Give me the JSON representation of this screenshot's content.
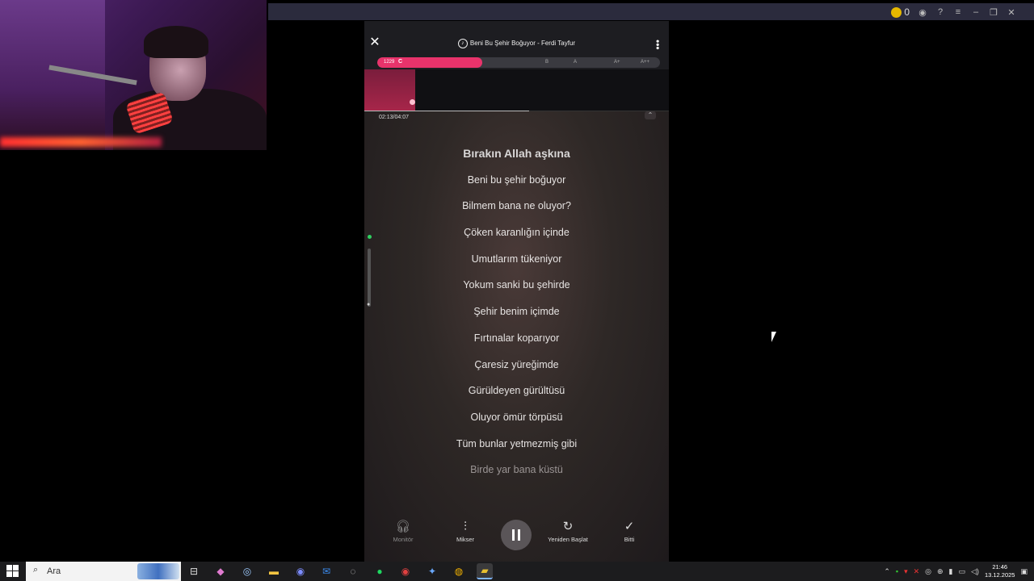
{
  "app": {
    "song_title": "Beni Bu Şehir Boğuyor - Ferdi Tayfur",
    "score": {
      "value": "1229",
      "grade": "C",
      "fill_fraction": 0.37
    },
    "grades": [
      "B",
      "A",
      "A+",
      "A++"
    ],
    "time": "02:13/04:07",
    "progress_fraction": 0.54,
    "lyrics": [
      "Bırakın Allah aşkına",
      "Beni bu şehir boğuyor",
      "Bilmem bana ne oluyor?",
      "Çöken karanlığın içinde",
      "Umutlarım tükeniyor",
      "Yokum sanki bu şehirde",
      "Şehir benim içimde",
      "Fırtınalar koparıyor",
      "Çaresiz yüreğimde",
      "Gürüldeyen gürültüsü",
      "Oluyor ömür törpüsü",
      "Tüm bunlar yetmezmiş gibi",
      "Birde yar bana küstü"
    ],
    "controls": {
      "monitor": "Monitör",
      "mixer": "Mikser",
      "restart": "Yeniden Başlat",
      "done": "Bitti"
    }
  },
  "topbar": {
    "coins": "0"
  },
  "taskbar": {
    "search_text": "Ara",
    "time": "21:46",
    "date": "13.12.2025"
  }
}
